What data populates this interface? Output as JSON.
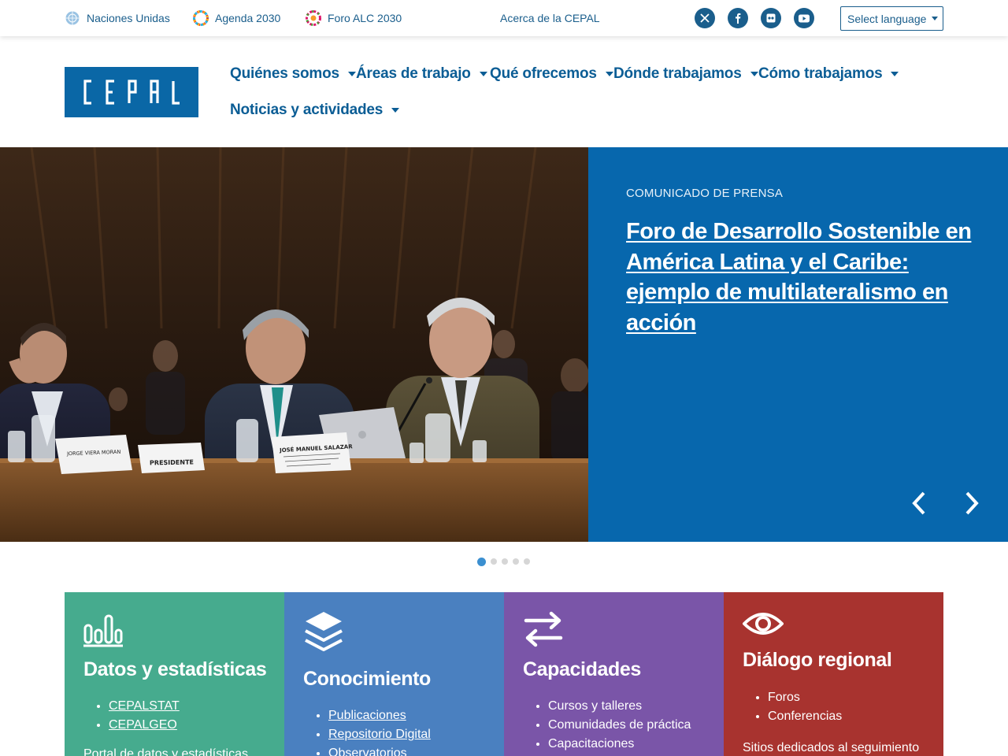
{
  "topbar": {
    "links": [
      {
        "label": "Naciones Unidas",
        "icon": "un-emblem-icon"
      },
      {
        "label": "Agenda 2030",
        "icon": "sdg-wheel-icon"
      },
      {
        "label": "Foro ALC 2030",
        "icon": "foro-alc-icon"
      }
    ],
    "about": "Acerca de la CEPAL",
    "social": [
      "x-icon",
      "facebook-icon",
      "flickr-icon",
      "youtube-icon"
    ],
    "language": "Select language"
  },
  "header": {
    "logo_text": "CEPAL",
    "nav": [
      {
        "label": "Quiénes somos"
      },
      {
        "label": "Áreas de trabajo"
      },
      {
        "label": "Qué ofrecemos"
      },
      {
        "label": "Dónde trabajamos"
      },
      {
        "label": "Cómo trabajamos"
      },
      {
        "label": "Noticias y actividades"
      }
    ]
  },
  "hero": {
    "kicker": "COMUNICADO DE PRENSA",
    "headline": "Foro de Desarrollo Sostenible en América Latina y el Caribe: ejemplo de multilateralismo en acción",
    "placards": [
      "JORGE VIERA MORAN",
      "PRESIDENTE",
      "JOSÉ MANUEL SALAZAR"
    ],
    "slides_total": 5,
    "active_slide": 1
  },
  "cards": [
    {
      "title": "Datos y estadísticas",
      "icon": "bar-chart-icon",
      "color": "#46ab8e",
      "items": [
        "CEPALSTAT",
        "CEPALGEO"
      ],
      "desc": "Portal de datos y estadísticas"
    },
    {
      "title": "Conocimiento",
      "icon": "layers-icon",
      "color": "#4a80c0",
      "items": [
        "Publicaciones",
        "Repositorio Digital",
        "Observatorios"
      ]
    },
    {
      "title": "Capacidades",
      "icon": "exchange-arrows-icon",
      "color": "#7a55a8",
      "items": [
        "Cursos y talleres",
        "Comunidades de práctica",
        "Capacitaciones"
      ]
    },
    {
      "title": "Diálogo regional",
      "icon": "eye-icon",
      "color": "#a8332f",
      "items": [
        "Foros",
        "Conferencias"
      ],
      "desc": "Sitios dedicados al seguimiento"
    }
  ],
  "colors": {
    "brand": "#0767ad",
    "nav_text": "#0b5d95",
    "link": "#1a5e8c"
  }
}
